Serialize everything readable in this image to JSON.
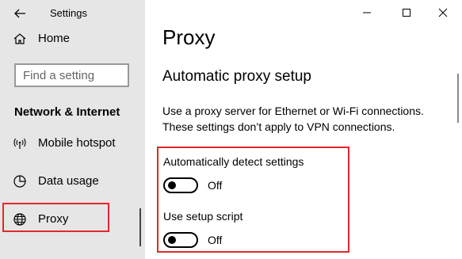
{
  "window": {
    "title": "Settings"
  },
  "sidebar": {
    "home_label": "Home",
    "search_placeholder": "Find a setting",
    "section_heading": "Network & Internet",
    "items": [
      {
        "label": "Mobile hotspot",
        "icon": "hotspot-icon"
      },
      {
        "label": "Data usage",
        "icon": "data-usage-icon"
      },
      {
        "label": "Proxy",
        "icon": "globe-icon",
        "selected": true
      }
    ]
  },
  "main": {
    "page_title": "Proxy",
    "section_title": "Automatic proxy setup",
    "description_line1": "Use a proxy server for Ethernet or Wi-Fi connections.",
    "description_line2": "These settings don’t apply to VPN connections.",
    "settings": [
      {
        "label": "Automatically detect settings",
        "state": "Off",
        "on": false
      },
      {
        "label": "Use setup script",
        "state": "Off",
        "on": false
      }
    ]
  },
  "colors": {
    "sidebar_bg": "#e6e6e6",
    "highlight_red": "#e0282d",
    "text": "#000000"
  }
}
